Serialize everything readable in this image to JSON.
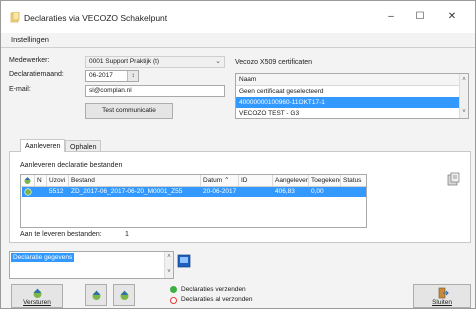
{
  "window": {
    "title": "Declaraties via VECOZO Schakelpunt",
    "minimize_icon": "minimize-icon",
    "maximize_icon": "maximize-icon",
    "close_icon": "close-icon"
  },
  "menu": {
    "instellingen": "Instellingen"
  },
  "form": {
    "medewerker_label": "Medewerker:",
    "medewerker_value": "0001 Support Praktijk (t)",
    "declaratiemaand_label": "Declaratiemaand:",
    "declaratiemaand_value": "06-2017",
    "email_label": "E-mail:",
    "email_value": "sl@complan.nl",
    "test_button": "Test communicatie"
  },
  "certificates": {
    "title": "Vecozo X509 certificaten",
    "column": "Naam",
    "items": [
      "Geen certificaat geselecteerd",
      "40000000100960-11OKT17-1",
      "VECOZO TEST - G3"
    ],
    "selected_index": 1
  },
  "tabs": {
    "aanleveren": "Aanleveren",
    "ophalen": "Ophalen"
  },
  "aanleveren": {
    "section_title": "Aanleveren declaratie bestanden",
    "columns": [
      "",
      "N",
      "Uzovi",
      "Bestand",
      "Datum",
      "ID",
      "Aangeleverd",
      "Toegekend",
      "Status"
    ],
    "rows": [
      {
        "n": "",
        "uzovi": "5512",
        "bestand": "ZD_2017-06_2017-06-20_M0001_Z55",
        "datum": "20-06-2017",
        "id": "",
        "aangeleverd": "406,83",
        "toegekend": "0,00",
        "status": ""
      }
    ],
    "count_label": "Aan te leveren bestanden:",
    "count_value": "1"
  },
  "bottom": {
    "memo_text": "Declaratie gegevens",
    "legend_send": "Declaraties verzenden",
    "legend_sent": "Declaraties al verzonden",
    "versturen": "Versturen",
    "sluiten": "Sluiten"
  },
  "colors": {
    "selection": "#3399ff",
    "ok": "#3cb043",
    "stop": "#e53935"
  }
}
